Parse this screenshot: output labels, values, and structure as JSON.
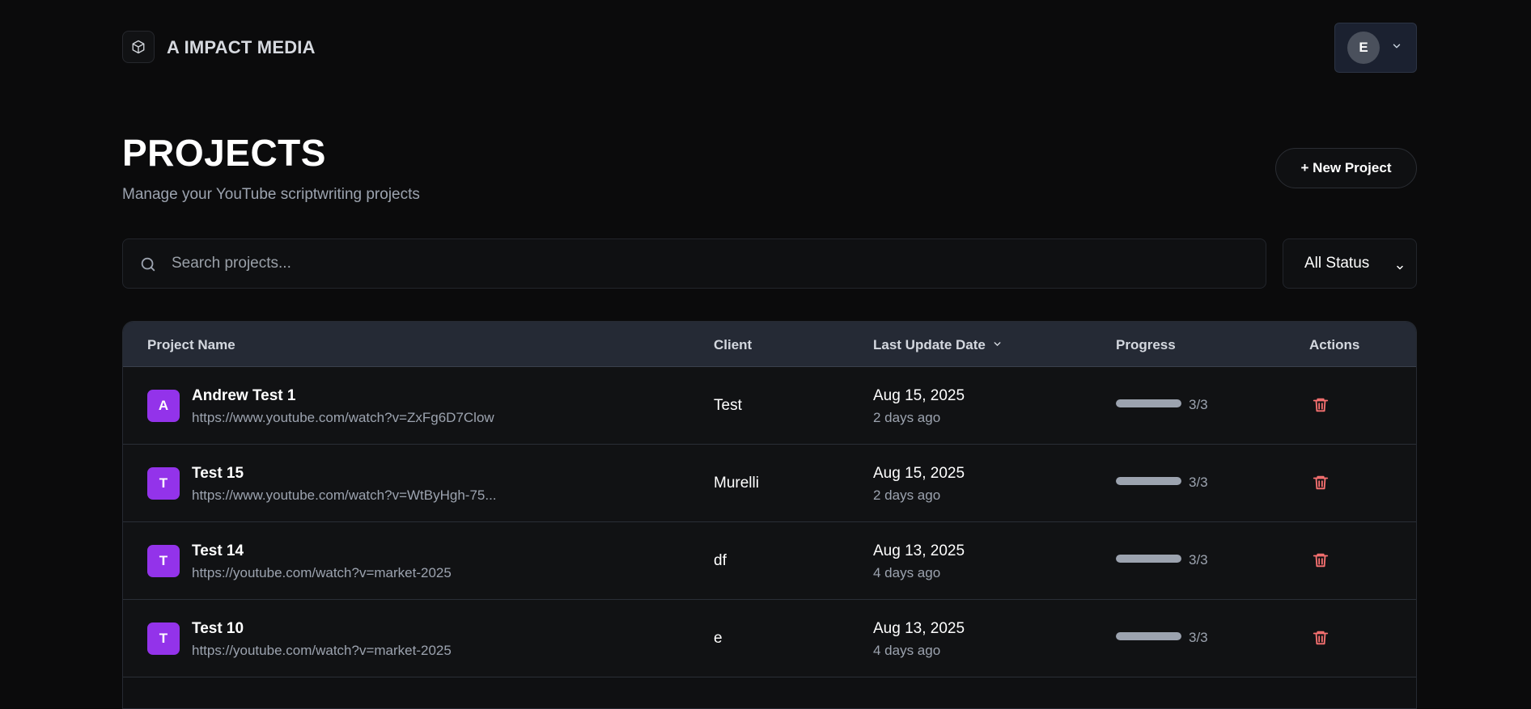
{
  "brand": {
    "name": "A IMPACT MEDIA",
    "logo_icon": "cube-icon"
  },
  "user": {
    "initial": "E"
  },
  "page": {
    "title": "PROJECTS",
    "subtitle": "Manage your YouTube scriptwriting projects",
    "new_project_label": "+ New Project"
  },
  "search": {
    "placeholder": "Search projects...",
    "value": ""
  },
  "filter": {
    "selected": "All Status"
  },
  "table": {
    "headers": {
      "name": "Project Name",
      "client": "Client",
      "date": "Last Update Date",
      "progress": "Progress",
      "actions": "Actions"
    },
    "rows": [
      {
        "initial": "A",
        "name": "Andrew Test 1",
        "url": "https://www.youtube.com/watch?v=ZxFg6D7Clow",
        "client": "Test",
        "date": "Aug 15, 2025",
        "ago": "2 days ago",
        "progress_text": "3/3",
        "progress_fraction": 1.0
      },
      {
        "initial": "T",
        "name": "Test 15",
        "url": "https://www.youtube.com/watch?v=WtByHgh-75...",
        "client": "Murelli",
        "date": "Aug 15, 2025",
        "ago": "2 days ago",
        "progress_text": "3/3",
        "progress_fraction": 1.0
      },
      {
        "initial": "T",
        "name": "Test 14",
        "url": "https://youtube.com/watch?v=market-2025",
        "client": "df",
        "date": "Aug 13, 2025",
        "ago": "4 days ago",
        "progress_text": "3/3",
        "progress_fraction": 1.0
      },
      {
        "initial": "T",
        "name": "Test 10",
        "url": "https://youtube.com/watch?v=market-2025",
        "client": "e",
        "date": "Aug 13, 2025",
        "ago": "4 days ago",
        "progress_text": "3/3",
        "progress_fraction": 1.0
      }
    ]
  },
  "colors": {
    "accent_avatar": "#9333ea",
    "delete": "#f87171",
    "background": "#0b0b0c"
  }
}
